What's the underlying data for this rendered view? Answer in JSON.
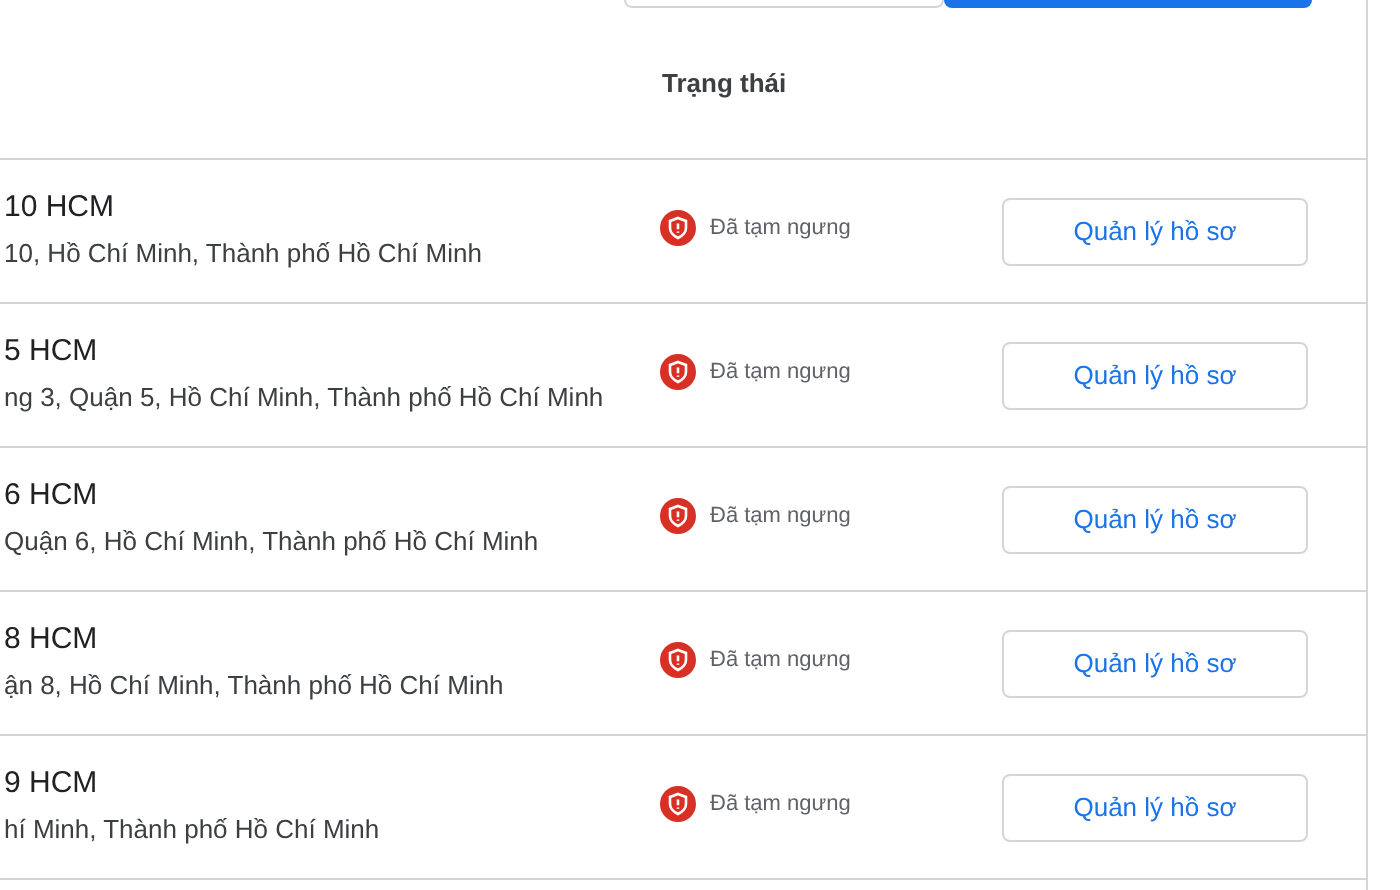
{
  "top_buttons": [
    {
      "kind": "outlined"
    },
    {
      "kind": "filled"
    }
  ],
  "table": {
    "columns": [
      {
        "label": "Trạng thái"
      }
    ],
    "rows": [
      {
        "name": "10 HCM",
        "address": "10, Hồ Chí Minh, Thành phố Hồ Chí Minh",
        "status": "Đã tạm ngưng",
        "action": "Quản lý hồ sơ"
      },
      {
        "name": "5 HCM",
        "address": "ng 3, Quận 5, Hồ Chí Minh, Thành phố Hồ Chí Minh",
        "status": "Đã tạm ngưng",
        "action": "Quản lý hồ sơ"
      },
      {
        "name": "6 HCM",
        "address": "Quận 6, Hồ Chí Minh, Thành phố Hồ Chí Minh",
        "status": "Đã tạm ngưng",
        "action": "Quản lý hồ sơ"
      },
      {
        "name": "8 HCM",
        "address": "ận 8, Hồ Chí Minh, Thành phố Hồ Chí Minh",
        "status": "Đã tạm ngưng",
        "action": "Quản lý hồ sơ"
      },
      {
        "name": "9 HCM",
        "address": "hí Minh, Thành phố Hồ Chí Minh",
        "status": "Đã tạm ngưng",
        "action": "Quản lý hồ sơ"
      }
    ]
  }
}
